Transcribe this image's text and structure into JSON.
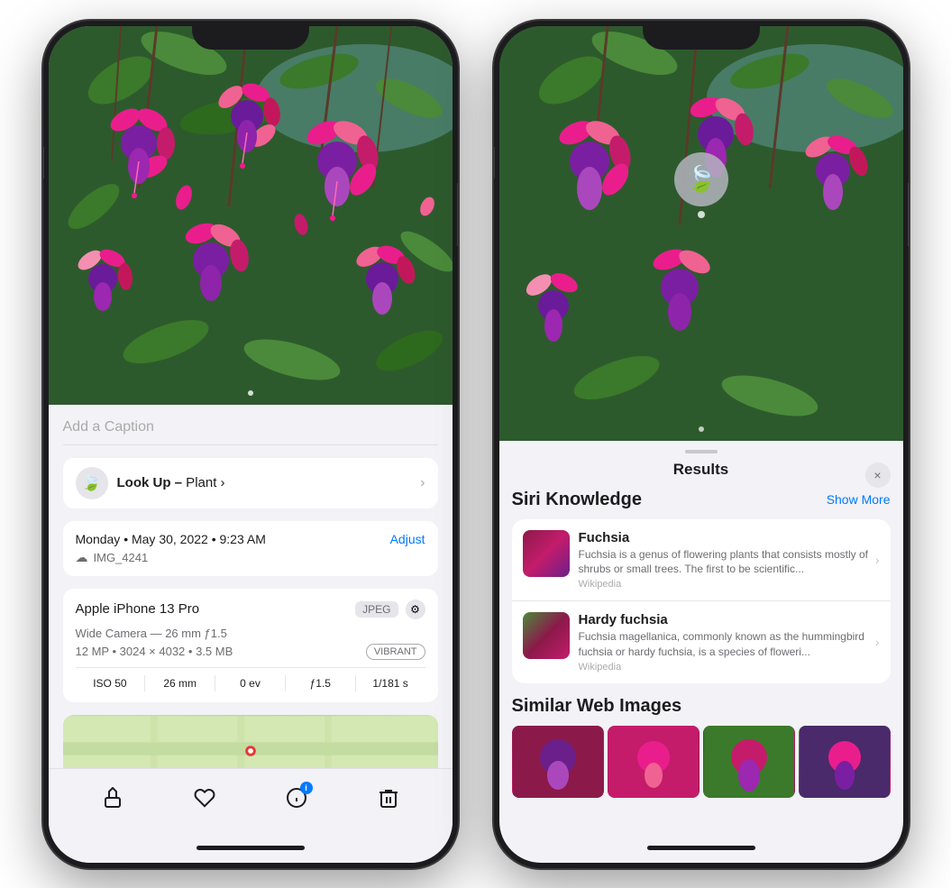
{
  "left_phone": {
    "caption_placeholder": "Add a Caption",
    "lookup": {
      "label": "Look Up –",
      "subject": " Plant",
      "chevron": "›"
    },
    "meta": {
      "date": "Monday • May 30, 2022 • 9:23 AM",
      "adjust_label": "Adjust",
      "cloud_icon": "☁",
      "filename": "IMG_4241"
    },
    "device": {
      "name": "Apple iPhone 13 Pro",
      "jpeg_badge": "JPEG",
      "camera": "Wide Camera — 26 mm ƒ1.5",
      "mp": "12 MP",
      "resolution": "3024 × 4032",
      "size": "3.5 MB",
      "vibrant_badge": "VIBRANT",
      "iso": "ISO 50",
      "focal": "26 mm",
      "ev": "0 ev",
      "aperture": "ƒ1.5",
      "shutter": "1/181 s"
    },
    "toolbar": {
      "share_icon": "↑",
      "heart_icon": "♡",
      "info_icon": "i",
      "trash_icon": "🗑"
    }
  },
  "right_phone": {
    "results_title": "Results",
    "close_label": "×",
    "siri_knowledge_title": "Siri Knowledge",
    "show_more_label": "Show More",
    "items": [
      {
        "name": "Fuchsia",
        "description": "Fuchsia is a genus of flowering plants that consists mostly of shrubs or small trees. The first to be scientific...",
        "source": "Wikipedia"
      },
      {
        "name": "Hardy fuchsia",
        "description": "Fuchsia magellanica, commonly known as the hummingbird fuchsia or hardy fuchsia, is a species of floweri...",
        "source": "Wikipedia"
      }
    ],
    "similar_web_images_title": "Similar Web Images"
  }
}
